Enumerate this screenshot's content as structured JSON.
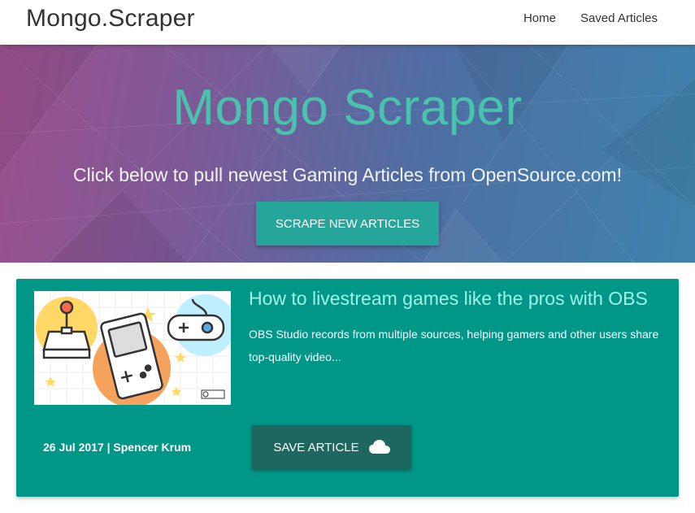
{
  "navbar": {
    "brand": "Mongo.Scraper",
    "links": [
      {
        "label": "Home"
      },
      {
        "label": "Saved Articles"
      }
    ]
  },
  "hero": {
    "title": "Mongo Scraper",
    "subtitle": "Click below to pull newest Gaming Articles from OpenSource.com!",
    "button_label": "SCRAPE NEW ARTICLES"
  },
  "articles": [
    {
      "title": "How to livestream games like the pros with OBS",
      "summary": "OBS Studio records from multiple sources, helping gamers and other users share top-quality video...",
      "meta": "26 Jul 2017 | Spencer Krum",
      "save_label": "SAVE ARTICLE",
      "save_icon": "cloud-icon",
      "image_icon": "game-controllers-illustration"
    }
  ],
  "colors": {
    "accent": "#26a69a",
    "card_background": "#009688",
    "save_button": "#1d675e",
    "hero_title": "#4bc2ad",
    "article_title": "#9ff3e6"
  }
}
